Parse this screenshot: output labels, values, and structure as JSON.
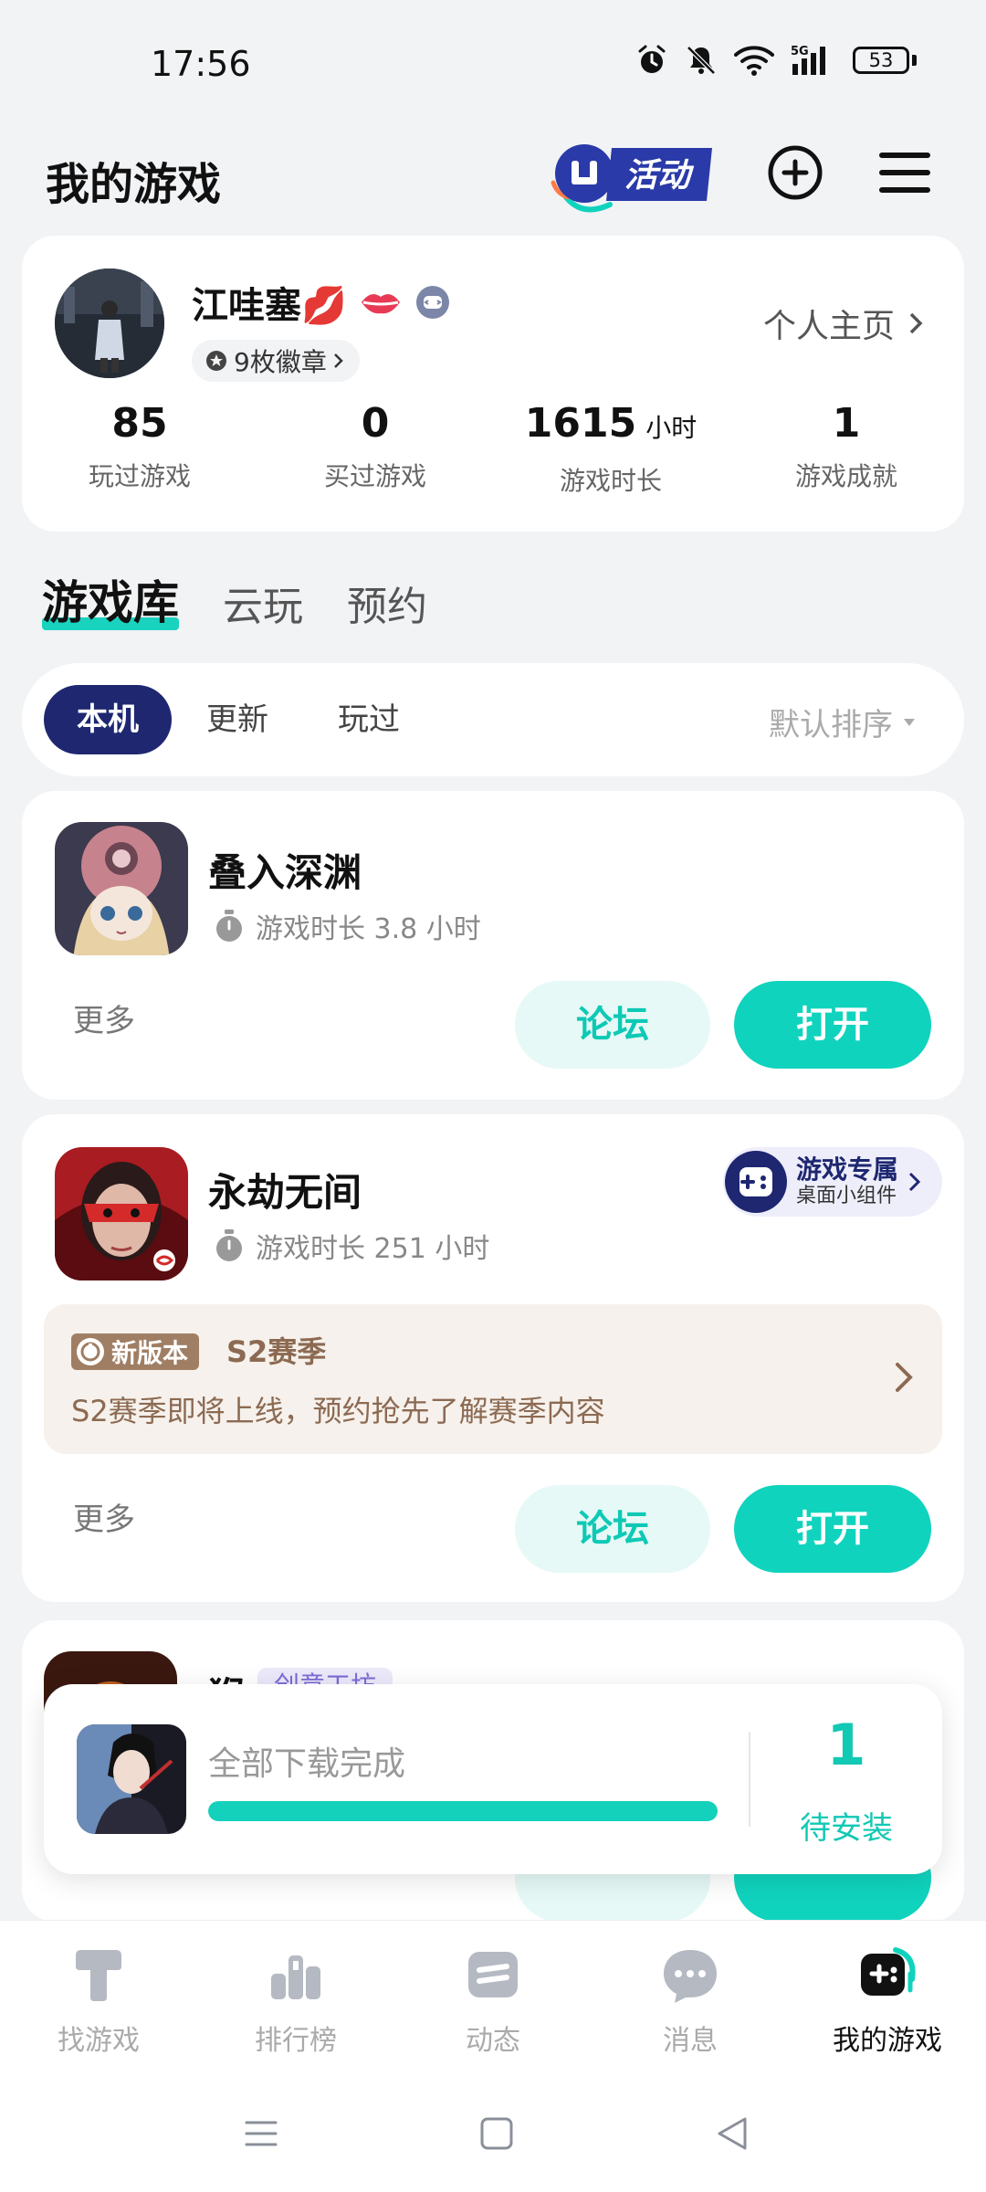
{
  "status_bar": {
    "time": "17:56",
    "battery": "53",
    "network": "5G"
  },
  "header": {
    "title": "我的游戏",
    "activity_text": "活动"
  },
  "profile": {
    "username": "江哇塞💋",
    "badges_label": "9枚徽章",
    "homepage_label": "个人主页",
    "stats": [
      {
        "value": "85",
        "unit": "",
        "label": "玩过游戏"
      },
      {
        "value": "0",
        "unit": "",
        "label": "买过游戏"
      },
      {
        "value": "1615",
        "unit": "小时",
        "label": "游戏时长"
      },
      {
        "value": "1",
        "unit": "",
        "label": "游戏成就"
      }
    ]
  },
  "main_tabs": [
    {
      "label": "游戏库",
      "active": true
    },
    {
      "label": "云玩",
      "active": false
    },
    {
      "label": "预约",
      "active": false
    }
  ],
  "filters": {
    "chips": [
      {
        "label": "本机",
        "active": true
      },
      {
        "label": "更新",
        "active": false
      },
      {
        "label": "玩过",
        "active": false
      }
    ],
    "sort_label": "默认排序"
  },
  "games": [
    {
      "name": "叠入深渊",
      "playtime": "游戏时长 3.8 小时",
      "more": "更多",
      "forum": "论坛",
      "open": "打开"
    },
    {
      "name": "永劫无间",
      "playtime": "游戏时长 251 小时",
      "more": "更多",
      "forum": "论坛",
      "open": "打开",
      "widget": {
        "title": "游戏专属",
        "subtitle": "桌面小组件"
      },
      "version": {
        "tag": "新版本",
        "season": "S2赛季",
        "desc": "S2赛季即将上线，预约抢先了解赛季内容"
      }
    },
    {
      "name_partial": "猴",
      "tag_partial": "创意工坊"
    }
  ],
  "download": {
    "status": "全部下载完成",
    "progress": 1.0,
    "pending_count": "1",
    "pending_label": "待安装"
  },
  "bottom_nav": [
    {
      "label": "找游戏",
      "icon": "find-game-icon",
      "active": false
    },
    {
      "label": "排行榜",
      "icon": "ranking-icon",
      "active": false
    },
    {
      "label": "动态",
      "icon": "feed-icon",
      "active": false
    },
    {
      "label": "消息",
      "icon": "message-icon",
      "active": false
    },
    {
      "label": "我的游戏",
      "icon": "my-games-icon",
      "active": true
    }
  ],
  "colors": {
    "accent": "#10d3bd",
    "navy": "#1e2770",
    "bg": "#f2f3f5"
  }
}
